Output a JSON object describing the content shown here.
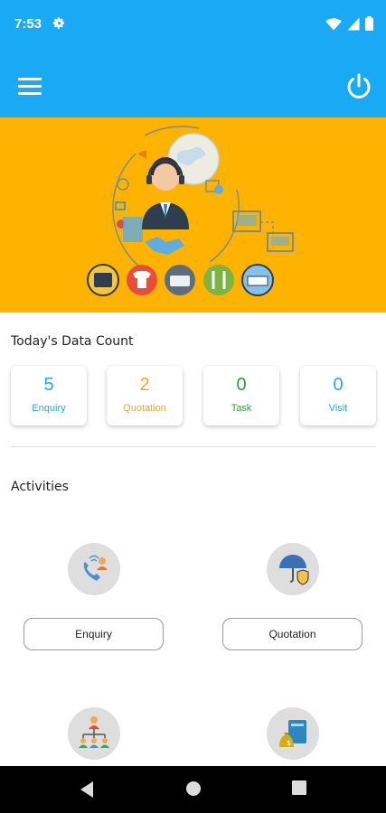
{
  "status_bar": {
    "time": "7:53",
    "icons": [
      "gear-icon",
      "wifi-icon",
      "signal-icon",
      "battery-icon"
    ]
  },
  "app_bar": {
    "menu_icon": "hamburger-menu-icon",
    "power_icon": "power-icon",
    "color": "#1aa9f5"
  },
  "banner": {
    "color": "#fdb300",
    "illustration": "support-agent-illustration"
  },
  "data_count": {
    "title": "Today's Data Count",
    "cards": [
      {
        "value": "5",
        "label": "Enquiry",
        "color": "#1aa9f5"
      },
      {
        "value": "2",
        "label": "Quotation",
        "color": "#f5a623"
      },
      {
        "value": "0",
        "label": "Task",
        "color": "#2e9e3e"
      },
      {
        "value": "0",
        "label": "Visit",
        "color": "#20b3c4"
      }
    ]
  },
  "activities": {
    "title": "Activities",
    "items": [
      {
        "label": "Enquiry",
        "icon": "phone-call-icon"
      },
      {
        "label": "Quotation",
        "icon": "umbrella-shield-icon"
      },
      {
        "label": "",
        "icon": "team-hierarchy-icon"
      },
      {
        "label": "",
        "icon": "money-book-icon"
      }
    ]
  },
  "nav_bar": {
    "icons": [
      "back-icon",
      "home-icon",
      "recents-icon"
    ]
  }
}
